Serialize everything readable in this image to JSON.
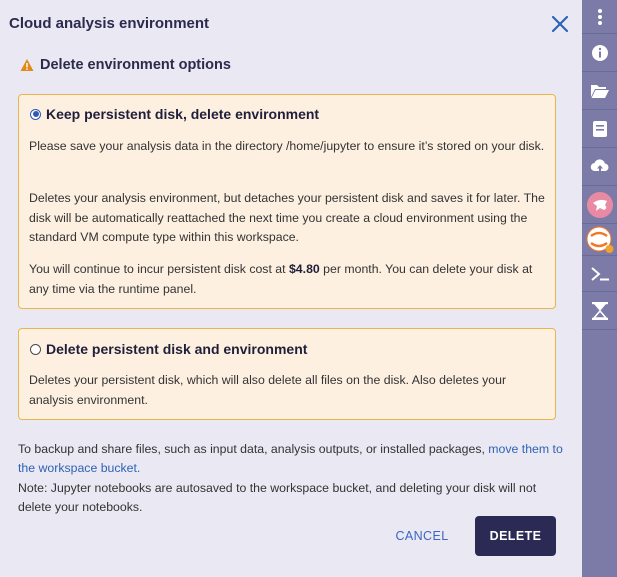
{
  "header": {
    "title": "Cloud analysis environment",
    "close_icon": "close-icon"
  },
  "warning": {
    "icon": "warning-icon",
    "title": "Delete environment options"
  },
  "options": [
    {
      "label": "Keep persistent disk, delete environment",
      "selected": true,
      "paragraphs": [
        "Please save your analysis data in the directory /home/jupyter to ensure it’s stored on your disk.",
        "Deletes your analysis environment, but detaches your persistent disk and saves it for later. The disk will be automatically reattached the next time you create a cloud environment using the standard VM compute type within this workspace."
      ],
      "cost_prefix": "You will continue to incur persistent disk cost at ",
      "cost_value": "$4.80",
      "cost_suffix": " per month. You can delete your disk at any time via the runtime panel."
    },
    {
      "label": "Delete persistent disk and environment",
      "selected": false,
      "paragraphs": [
        "Deletes your persistent disk, which will also delete all files on the disk. Also deletes your analysis environment."
      ]
    }
  ],
  "footer": {
    "backup_text": "To backup and share files, such as input data, analysis outputs, or installed packages, ",
    "backup_link": "move them to the workspace bucket.",
    "note": "Note: Jupyter notebooks are autosaved to the workspace bucket, and deleting your disk will not delete your notebooks."
  },
  "buttons": {
    "cancel": "CANCEL",
    "delete": "DELETE"
  },
  "sidebar": {
    "items": [
      {
        "icon": "more-vertical-icon"
      },
      {
        "icon": "info-icon"
      },
      {
        "icon": "folder-open-icon"
      },
      {
        "icon": "notebook-icon"
      },
      {
        "icon": "cloud-upload-icon"
      },
      {
        "icon": "galaxy-icon"
      },
      {
        "icon": "jupyter-icon",
        "label": "jupyter"
      },
      {
        "icon": "terminal-icon"
      },
      {
        "icon": "cromwell-icon"
      }
    ]
  },
  "colors": {
    "background": "#e9e8f3",
    "card_background": "#fdf0e1",
    "card_border": "#e8b64b",
    "primary_button": "#2a2a55",
    "link": "#2f63b3",
    "sidebar": "#7c7aa6",
    "warning": "#e08a1b",
    "status_dot": "#f2a32d"
  }
}
